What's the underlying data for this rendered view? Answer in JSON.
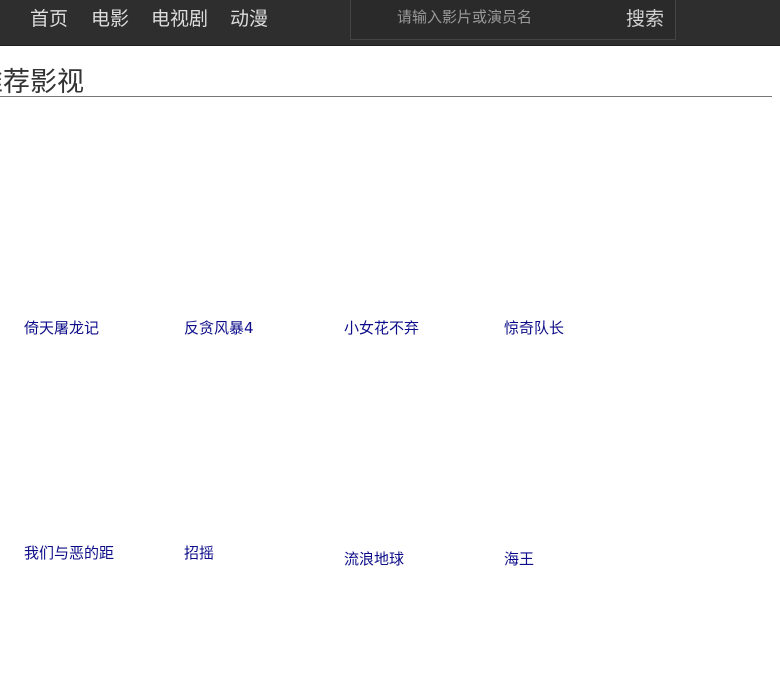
{
  "nav": {
    "items": [
      {
        "label": "首页"
      },
      {
        "label": "电影"
      },
      {
        "label": "电视剧"
      },
      {
        "label": "动漫"
      }
    ]
  },
  "search": {
    "placeholder": "请输入影片或演员名",
    "value": "",
    "button_label": "搜索"
  },
  "main": {
    "section_title": "推荐影视",
    "movies": [
      {
        "title": "倚天屠龙记"
      },
      {
        "title": "反贪风暴4"
      },
      {
        "title": "小女花不弃"
      },
      {
        "title": "惊奇队长"
      },
      {
        "title": "我们与恶的距"
      },
      {
        "title": "招摇"
      },
      {
        "title": "流浪地球"
      },
      {
        "title": "海王"
      }
    ]
  },
  "colors": {
    "navbar_bg": "#2e2e2e",
    "link": "#0d0d8a"
  }
}
